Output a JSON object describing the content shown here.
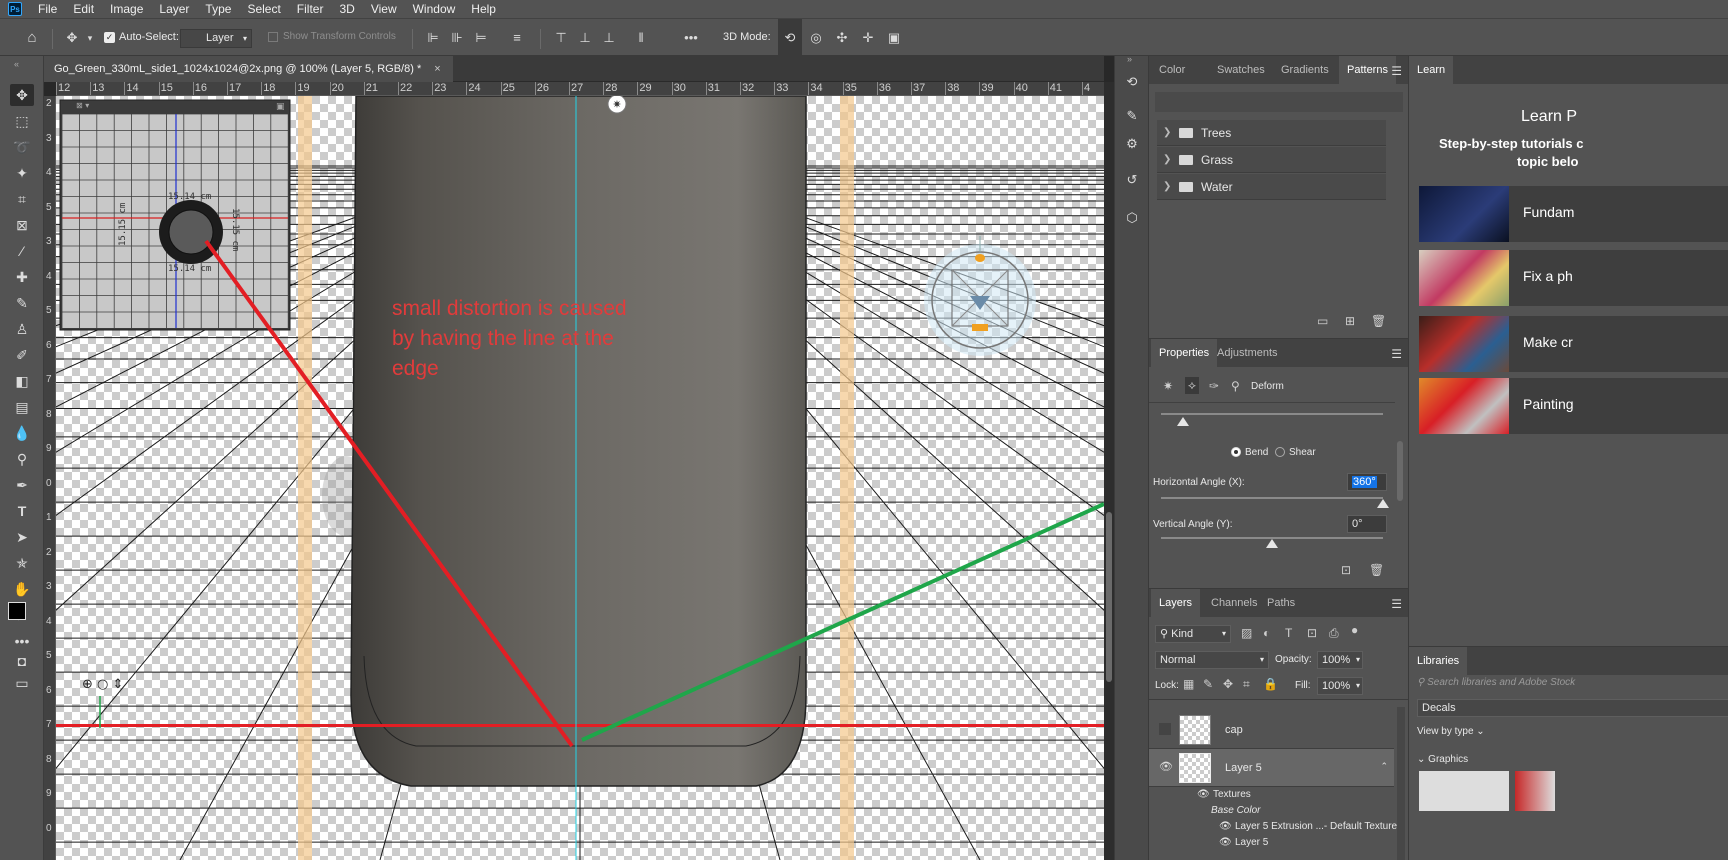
{
  "app": {
    "logo": "Ps"
  },
  "menu": [
    "File",
    "Edit",
    "Image",
    "Layer",
    "Type",
    "Select",
    "Filter",
    "3D",
    "View",
    "Window",
    "Help"
  ],
  "options": {
    "auto_select_label": "Auto-Select:",
    "auto_select_value": "Layer",
    "show_transform_label": "Show Transform Controls",
    "more": "•••",
    "mode_3d_label": "3D Mode:"
  },
  "document": {
    "tab_title": "Go_Green_330mL_side1_1024x1024@2x.png @ 100% (Layer 5, RGB/8) *",
    "close": "×",
    "ruler_top": [
      "12",
      "13",
      "14",
      "15",
      "16",
      "17",
      "18",
      "19",
      "20",
      "21",
      "22",
      "23",
      "24",
      "25",
      "26",
      "27",
      "28",
      "29",
      "30",
      "31",
      "32",
      "33",
      "34",
      "35",
      "36",
      "37",
      "38",
      "39",
      "40",
      "41",
      "4"
    ],
    "ruler_left": [
      "2",
      "3",
      "4",
      "5",
      "3",
      "4",
      "5",
      "6",
      "7",
      "8",
      "9",
      "0",
      "1",
      "2",
      "3",
      "4",
      "5",
      "6",
      "7",
      "8",
      "9",
      "0"
    ],
    "annotation": "small distortion is caused by having the line at the edge",
    "mini_view": {
      "dim_top": "15.14 cm",
      "dim_bottom": "15.14 cm",
      "dim_left": "15.15 cm",
      "dim_right": "15.15 cm"
    }
  },
  "patterns_panel": {
    "tabs": [
      "Color",
      "Swatches",
      "Gradients",
      "Patterns"
    ],
    "active_tab": "Patterns",
    "folders": [
      "Trees",
      "Grass",
      "Water"
    ]
  },
  "properties_panel": {
    "tabs": [
      "Properties",
      "Adjustments"
    ],
    "active_tab": "Properties",
    "section": "Deform",
    "bend_label": "Bend",
    "shear_label": "Shear",
    "selected_mode": "Bend",
    "horizontal_angle_label": "Horizontal Angle (X):",
    "horizontal_angle_value": "360°",
    "horizontal_angle_level": 1.0,
    "vertical_angle_label": "Vertical Angle (Y):",
    "vertical_angle_value": "0°",
    "vertical_angle_level": 0.5
  },
  "layers_panel": {
    "tabs": [
      "Layers",
      "Channels",
      "Paths"
    ],
    "active_tab": "Layers",
    "filter_kind": "Kind",
    "blend_mode": "Normal",
    "opacity_label": "Opacity:",
    "opacity_value": "100%",
    "lock_label": "Lock:",
    "fill_label": "Fill:",
    "fill_value": "100%",
    "layers": [
      {
        "name": "cap",
        "visible": false
      },
      {
        "name": "Layer 5",
        "visible": true
      }
    ],
    "sub_items": {
      "textures": "Textures",
      "base_color": "Base Color",
      "extrusion": "Layer 5 Extrusion ...- Default Texture",
      "layer5": "Layer 5"
    }
  },
  "learn_panel": {
    "tab": "Learn",
    "title": "Learn P",
    "subtitle_line1": "Step-by-step tutorials c",
    "subtitle_line2": "topic belo",
    "cards": [
      "Fundam",
      "Fix a ph",
      "Make cr",
      "Painting"
    ]
  },
  "libraries_panel": {
    "tab": "Libraries",
    "search_placeholder": "Search libraries and Adobe Stock",
    "library_value": "Decals",
    "view_by": "View by type",
    "group": "Graphics"
  },
  "colors": {
    "annotation_text": "#e23b3b",
    "red_line": "#e31e24",
    "green_line": "#1fa64a",
    "guide_cyan": "#22d3e6",
    "selection_blue": "#1473e6"
  }
}
